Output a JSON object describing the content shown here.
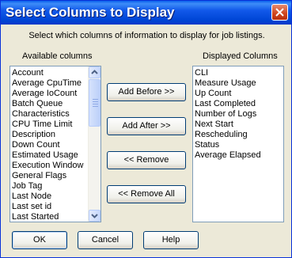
{
  "dialog": {
    "title": "Select Columns to Display",
    "description": "Select which columns of information to display for job listings."
  },
  "available": {
    "label": "Available columns",
    "items": [
      "Account",
      "Average CpuTime",
      "Average IoCount",
      "Batch Queue",
      "Characteristics",
      "CPU Time Limit",
      "Description",
      "Down Count",
      "Estimated Usage",
      "Execution Window",
      "General Flags",
      "Job Tag",
      "Last Node",
      "Last set id",
      "Last Started"
    ]
  },
  "displayed": {
    "label": "Displayed Columns",
    "items": [
      "CLI",
      "Measure Usage",
      "Up Count",
      "Last Completed",
      "Number of Logs",
      "Next Start",
      "Rescheduling",
      "Status",
      "Average Elapsed"
    ]
  },
  "actions": {
    "add_before": "Add Before >>",
    "add_after": "Add After >>",
    "remove": "<< Remove",
    "remove_all": "<< Remove All"
  },
  "footer": {
    "ok": "OK",
    "cancel": "Cancel",
    "help": "Help"
  }
}
